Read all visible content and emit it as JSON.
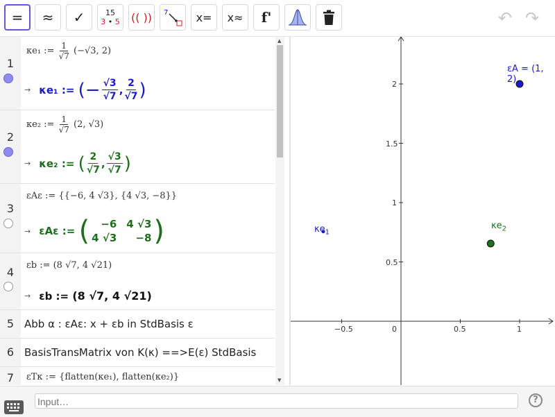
{
  "toolbar": {
    "equals_label": "=",
    "approx_label": "≈",
    "check_label": "✓",
    "fraction_top": "15",
    "fraction_bottom_left": "3",
    "fraction_bottom_dot": "•",
    "fraction_bottom_right": "5",
    "parens_label": "(( ))",
    "substitute_digit": "7",
    "solve_label": "x=",
    "nsolve_label": "x≈",
    "derivative_label": "f'",
    "undo": "↶",
    "redo": "↷"
  },
  "colors": {
    "blue": "#1a1ac6",
    "green": "#1e6e1e",
    "accent": "#6557d2"
  },
  "rows": [
    {
      "num": "1",
      "def_pre": "κe₁ := ",
      "def_frac_n": "1",
      "def_frac_d": "√7",
      "def_post": " (−√3, 2)",
      "out_name": "κe₁ :=",
      "out_open": "(−",
      "f1n": "√3",
      "f1d": "√7",
      "sep": ",",
      "f2n": "2",
      "f2d": "√7",
      "out_close": ")"
    },
    {
      "num": "2",
      "def_pre": "κe₂ := ",
      "def_frac_n": "1",
      "def_frac_d": "√7",
      "def_post": " (2, √3)",
      "out_name": "κe₂ :=",
      "out_open": "(",
      "f1n": "2",
      "f1d": "√7",
      "sep": ",",
      "f2n": "√3",
      "f2d": "√7",
      "out_close": ")"
    },
    {
      "num": "3",
      "def": "εAε := {{−6, 4 √3}, {4 √3, −8}}",
      "out_name": "εAε :=",
      "m11": "−6",
      "m12": "4 √3",
      "m21": "4 √3",
      "m22": "−8"
    },
    {
      "num": "4",
      "def": "εb := (8 √7, 4 √21)",
      "out_name": "εb :=",
      "out_value": "(8 √7, 4 √21)"
    },
    {
      "num": "5",
      "text": "Abb α : εAε: x + εb in StdBasis ε"
    },
    {
      "num": "6",
      "text": "BasisTransMatrix von K(κ) ==>E(ε) StdBasis"
    },
    {
      "num": "7",
      "def": "εTκ := {flatten(κe₁), flatten(κe₂)}"
    }
  ],
  "graph": {
    "x_ticks": [
      "−0.5",
      "0",
      "0.5",
      "1"
    ],
    "y_ticks": [
      "0.5",
      "1",
      "1.5",
      "2"
    ],
    "points": [
      {
        "label": "εA = (1, 2)",
        "x": 1,
        "y": 2,
        "color": "#1a1ac6"
      },
      {
        "label": "κe",
        "sub": "2",
        "x": 0.756,
        "y": 0.655,
        "color": "#1e6e1e"
      },
      {
        "label": "κe",
        "sub": "1",
        "x": -0.655,
        "y": 0.756,
        "color": "#1a1ac6"
      }
    ]
  },
  "input": {
    "placeholder": "Input…"
  },
  "help": "?"
}
